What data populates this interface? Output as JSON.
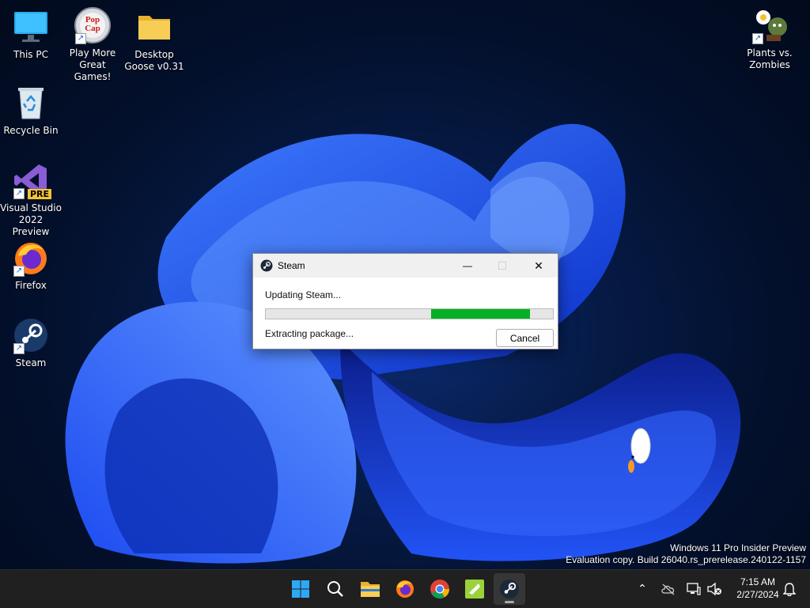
{
  "desktop": {
    "icons": [
      {
        "label": "This PC"
      },
      {
        "label": "Play More Great Games!",
        "badge": "Pop Cap"
      },
      {
        "label": "Desktop Goose v0.31"
      },
      {
        "label": "Recycle Bin"
      },
      {
        "label": "Visual Studio 2022 Preview",
        "badge": "PRE"
      },
      {
        "label": "Firefox"
      },
      {
        "label": "Steam"
      },
      {
        "label": "Plants vs. Zombies"
      }
    ],
    "watermark": {
      "line1": "Windows 11 Pro Insider Preview",
      "line2": "Evaluation copy. Build 26040.rs_prerelease.240122-1157"
    }
  },
  "dialog": {
    "title": "Steam",
    "status": "Updating Steam...",
    "progress_start": 0.575,
    "progress_end": 0.92,
    "substatus": "Extracting package...",
    "cancel_label": "Cancel",
    "minimize_glyph": "—",
    "maximize_glyph": "☐",
    "close_glyph": "✕"
  },
  "taskbar": {
    "apps": [
      "start-icon",
      "search-icon",
      "file-explorer-icon",
      "firefox-icon",
      "chrome-icon",
      "desktop-goose-icon",
      "steam-icon"
    ],
    "active_app": "steam-icon",
    "tray": {
      "chevron_glyph": "⌃"
    },
    "clock": {
      "time": "7:15 AM",
      "date": "2/27/2024"
    }
  },
  "colors": {
    "progress": "#06b025",
    "taskbar": "#202020",
    "accent": "#0067c0"
  }
}
